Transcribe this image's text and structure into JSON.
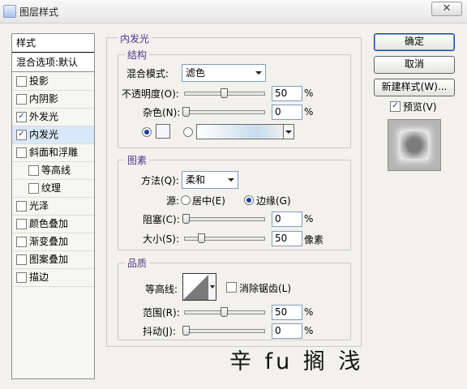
{
  "window": {
    "title": "图层样式",
    "close_glyph": "✕"
  },
  "styles_panel": {
    "header": "样式",
    "blend_options": "混合选项:默认",
    "items": [
      {
        "label": "投影",
        "checked": false,
        "indent": false
      },
      {
        "label": "内阴影",
        "checked": false,
        "indent": false
      },
      {
        "label": "外发光",
        "checked": true,
        "indent": false
      },
      {
        "label": "内发光",
        "checked": true,
        "indent": false,
        "selected": true
      },
      {
        "label": "斜面和浮雕",
        "checked": false,
        "indent": false
      },
      {
        "label": "等高线",
        "checked": false,
        "indent": true
      },
      {
        "label": "纹理",
        "checked": false,
        "indent": true
      },
      {
        "label": "光泽",
        "checked": false,
        "indent": false
      },
      {
        "label": "颜色叠加",
        "checked": false,
        "indent": false
      },
      {
        "label": "渐变叠加",
        "checked": false,
        "indent": false
      },
      {
        "label": "图案叠加",
        "checked": false,
        "indent": false
      },
      {
        "label": "描边",
        "checked": false,
        "indent": false
      }
    ]
  },
  "buttons": {
    "ok": "确定",
    "cancel": "取消",
    "new_style": "新建样式(W)...",
    "preview": "预览(V)",
    "preview_checked": true
  },
  "inner_glow": {
    "title": "内发光",
    "structure": {
      "title": "结构",
      "blend_mode_label": "混合模式:",
      "blend_mode_value": "滤色",
      "opacity_label": "不透明度(O):",
      "opacity_value": "50",
      "opacity_level": 0.5,
      "opacity_unit": "%",
      "noise_label": "杂色(N):",
      "noise_value": "0",
      "noise_level": 0,
      "noise_unit": "%",
      "color_swatch": "#f4f4fa"
    },
    "elements": {
      "title": "图素",
      "method_label": "方法(Q):",
      "method_value": "柔和",
      "source_label": "源:",
      "source_center": "居中(E)",
      "source_edge": "边缘(G)",
      "source_selected": "edge",
      "choke_label": "阻塞(C):",
      "choke_value": "0",
      "choke_level": 0,
      "choke_unit": "%",
      "size_label": "大小(S):",
      "size_value": "50",
      "size_level": 0.2,
      "size_unit": "像素"
    },
    "quality": {
      "title": "品质",
      "contour_label": "等高线:",
      "anti_alias_label": "消除锯齿(L)",
      "anti_alias_checked": false,
      "range_label": "范围(R):",
      "range_value": "50",
      "range_level": 0.5,
      "range_unit": "%",
      "jitter_label": "抖动(J):",
      "jitter_value": "0",
      "jitter_level": 0,
      "jitter_unit": "%"
    }
  },
  "watermark": "辛 fu 搁 浅"
}
